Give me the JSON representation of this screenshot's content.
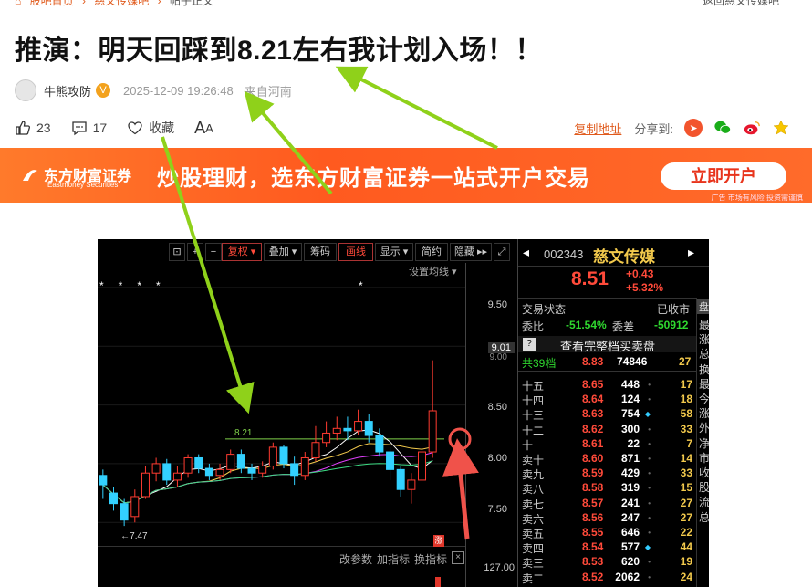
{
  "breadcrumb": {
    "items": [
      "股吧首页",
      "慈文传媒吧",
      "帖子正文"
    ],
    "back": "返回慈文传媒吧"
  },
  "post": {
    "title": "推演：明天回踩到8.21左右我计划入场！！",
    "author": "牛熊攻防",
    "datetime": "2025-12-09 19:26:48",
    "location": "来自河南"
  },
  "actions": {
    "likes": "23",
    "comments": "17",
    "favorite": "收藏",
    "font": "A",
    "font_small": "A"
  },
  "share": {
    "copy": "复制地址",
    "label": "分享到:"
  },
  "banner": {
    "brand": "东方财富证券",
    "brand_en": "Eastmoney Securities",
    "slogan": "炒股理财，选东方财富证券一站式开户交易",
    "button": "立即开户",
    "ad": "广告 市场有风险 投资需谨慎"
  },
  "chart": {
    "toolbar": [
      "复权",
      "叠加",
      "筹码",
      "画线",
      "显示",
      "简约",
      "隐藏"
    ],
    "setting": "设置均线",
    "y_labels": [
      "9.50",
      "9.01",
      "9.00",
      "8.50",
      "8.00",
      "7.50",
      "127.00"
    ],
    "annot_821": "8.21",
    "annot_747": "7.47",
    "rise": "涨",
    "bottom": [
      "改参数",
      "加指标",
      "换指标"
    ],
    "stars": [
      "*",
      "*",
      "*",
      "*",
      "*"
    ]
  },
  "chart_data": {
    "type": "candlestick",
    "ylim": [
      7.3,
      9.6
    ],
    "candles": [
      [
        7.9,
        7.82,
        7.95,
        7.7
      ],
      [
        7.75,
        7.66,
        7.8,
        7.6
      ],
      [
        7.66,
        7.52,
        7.7,
        7.47
      ],
      [
        7.55,
        7.72,
        7.78,
        7.5
      ],
      [
        7.72,
        7.92,
        7.98,
        7.7
      ],
      [
        7.92,
        8.0,
        8.05,
        7.85
      ],
      [
        8.0,
        7.86,
        8.04,
        7.82
      ],
      [
        7.86,
        7.92,
        7.98,
        7.8
      ],
      [
        7.92,
        8.05,
        8.08,
        7.88
      ],
      [
        8.05,
        7.96,
        8.08,
        7.92
      ],
      [
        7.96,
        7.9,
        8.0,
        7.86
      ],
      [
        7.9,
        7.95,
        8.0,
        7.86
      ],
      [
        7.95,
        8.08,
        8.12,
        7.92
      ],
      [
        8.08,
        7.96,
        8.12,
        7.92
      ],
      [
        7.96,
        7.92,
        8.0,
        7.86
      ],
      [
        7.92,
        7.98,
        8.02,
        7.88
      ],
      [
        7.98,
        8.14,
        8.18,
        7.95
      ],
      [
        8.14,
        8.0,
        8.16,
        7.96
      ],
      [
        8.0,
        7.9,
        8.06,
        7.82
      ],
      [
        7.9,
        8.05,
        8.1,
        7.86
      ],
      [
        8.05,
        8.18,
        8.32,
        8.02
      ],
      [
        8.18,
        8.26,
        8.36,
        8.14
      ],
      [
        8.26,
        8.3,
        8.4,
        8.2
      ],
      [
        8.3,
        8.28,
        8.4,
        8.2
      ],
      [
        8.28,
        8.36,
        8.46,
        8.24
      ],
      [
        8.36,
        8.24,
        8.42,
        8.18
      ],
      [
        8.24,
        8.1,
        8.3,
        8.06
      ],
      [
        8.1,
        7.95,
        8.14,
        7.86
      ],
      [
        7.95,
        7.78,
        7.98,
        7.72
      ],
      [
        7.78,
        7.86,
        7.92,
        7.66
      ],
      [
        7.86,
        8.1,
        8.18,
        7.82
      ],
      [
        8.1,
        8.45,
        8.88,
        8.05
      ]
    ]
  },
  "quote": {
    "code": "002343",
    "name": "慈文传媒",
    "price": "8.51",
    "change": "+0.43",
    "pct": "+5.32%",
    "status_label": "交易状态",
    "status": "已收市",
    "wb_label": "委比",
    "wb": "-51.54%",
    "wc_label": "委差",
    "wc": "-50912",
    "full_depth": "查看完整档买卖盘",
    "total_label": "共39档",
    "total_price": "8.83",
    "total_vol": "74846",
    "total_num": "27",
    "rows": [
      {
        "label": "十五",
        "price": "8.65",
        "vol": "448",
        "num": "17"
      },
      {
        "label": "十四",
        "price": "8.64",
        "vol": "124",
        "num": "18"
      },
      {
        "label": "十三",
        "price": "8.63",
        "vol": "754",
        "num": "58"
      },
      {
        "label": "十二",
        "price": "8.62",
        "vol": "300",
        "num": "33"
      },
      {
        "label": "十一",
        "price": "8.61",
        "vol": "22",
        "num": "7"
      },
      {
        "label": "卖十",
        "price": "8.60",
        "vol": "871",
        "num": "14"
      },
      {
        "label": "卖九",
        "price": "8.59",
        "vol": "429",
        "num": "33"
      },
      {
        "label": "卖八",
        "price": "8.58",
        "vol": "319",
        "num": "15"
      },
      {
        "label": "卖七",
        "price": "8.57",
        "vol": "241",
        "num": "27"
      },
      {
        "label": "卖六",
        "price": "8.56",
        "vol": "247",
        "num": "27"
      },
      {
        "label": "卖五",
        "price": "8.55",
        "vol": "646",
        "num": "22"
      },
      {
        "label": "卖四",
        "price": "8.54",
        "vol": "577",
        "num": "44"
      },
      {
        "label": "卖三",
        "price": "8.53",
        "vol": "620",
        "num": "19"
      },
      {
        "label": "卖二",
        "price": "8.52",
        "vol": "2062",
        "num": "24"
      }
    ],
    "side": [
      "最",
      "涨",
      "总",
      "换",
      "最",
      "今",
      "涨",
      "外",
      "净",
      "市",
      "收",
      "股",
      "流",
      "总"
    ]
  }
}
